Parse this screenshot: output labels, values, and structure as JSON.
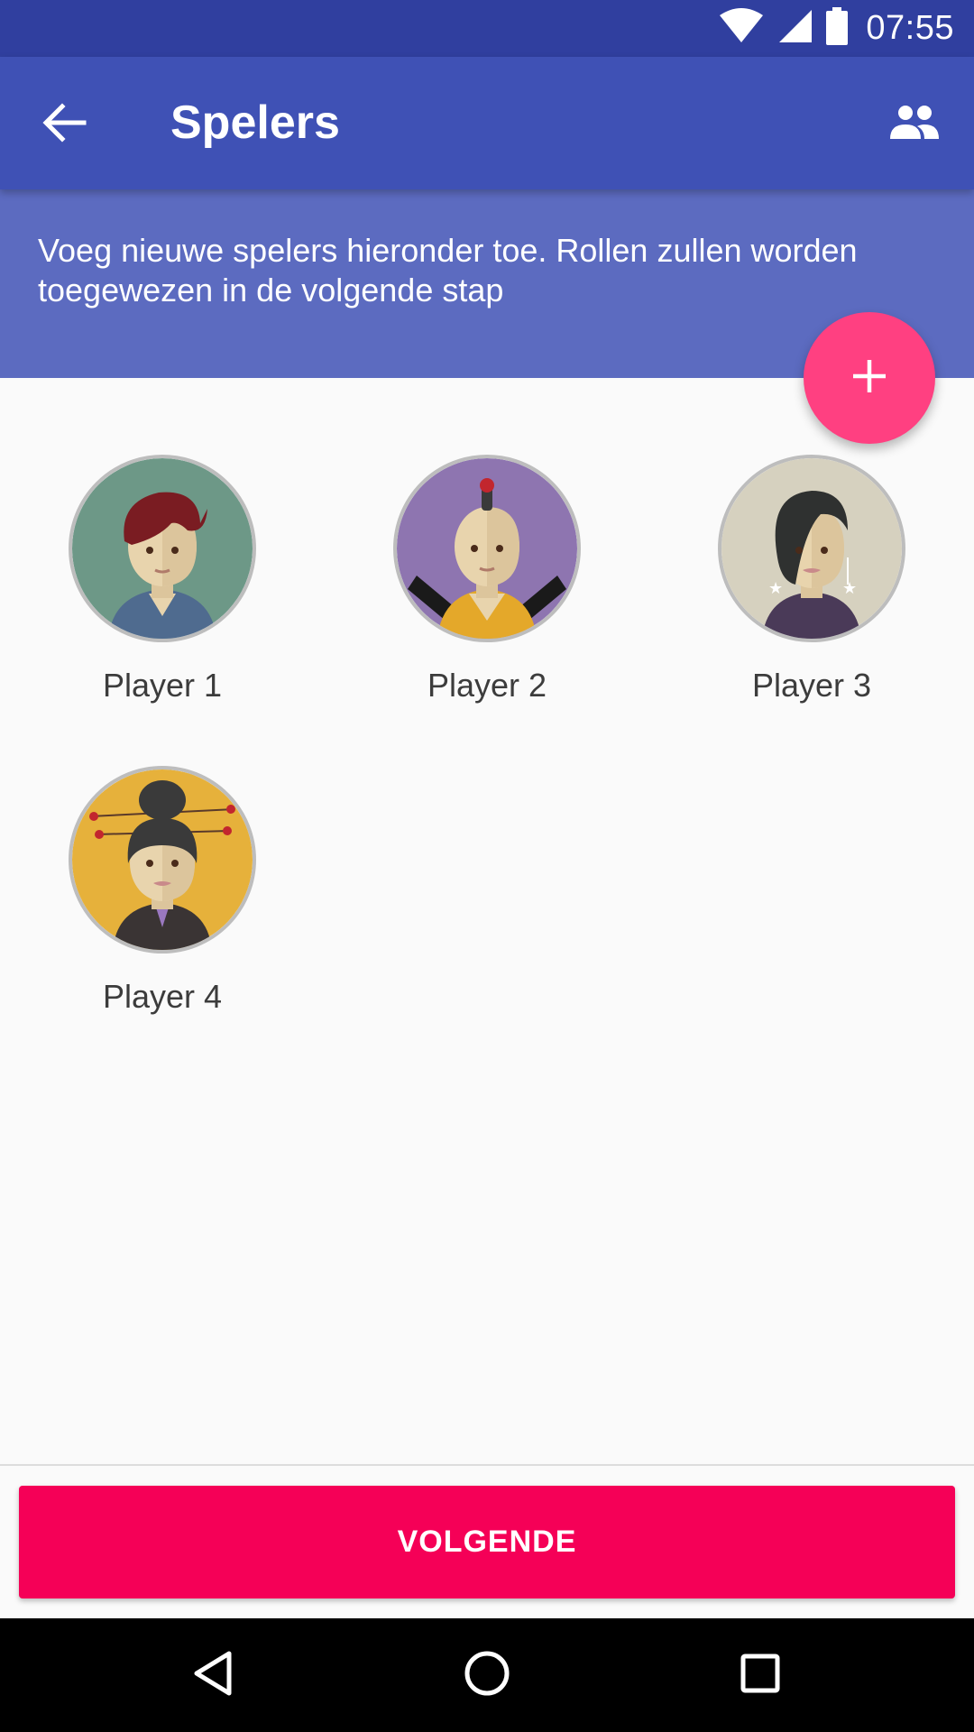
{
  "status_bar": {
    "time": "07:55",
    "icons": [
      "wifi-icon",
      "signal-icon",
      "battery-icon"
    ]
  },
  "app_bar": {
    "title": "Spelers",
    "back_icon": "arrow-back-icon",
    "action_icon": "people-icon"
  },
  "info": {
    "text": "Voeg nieuwe spelers hieronder toe. Rollen zullen worden toegewezen in de volgende stap"
  },
  "fab": {
    "icon": "add-icon"
  },
  "players": [
    {
      "name": "Player 1",
      "avatar_bg": "#6d9887"
    },
    {
      "name": "Player 2",
      "avatar_bg": "#8e75b0"
    },
    {
      "name": "Player 3",
      "avatar_bg": "#d6d1bf"
    },
    {
      "name": "Player 4",
      "avatar_bg": "#e6b13b"
    }
  ],
  "next_button": {
    "label": "VOLGENDE"
  },
  "nav_bar": {
    "icons": [
      "back-triangle-icon",
      "home-circle-icon",
      "recents-square-icon"
    ]
  },
  "colors": {
    "status_bar": "#303f9f",
    "app_bar": "#3f51b5",
    "info_header": "#5c6bc0",
    "fab": "#ff4081",
    "next_button": "#f50057"
  }
}
